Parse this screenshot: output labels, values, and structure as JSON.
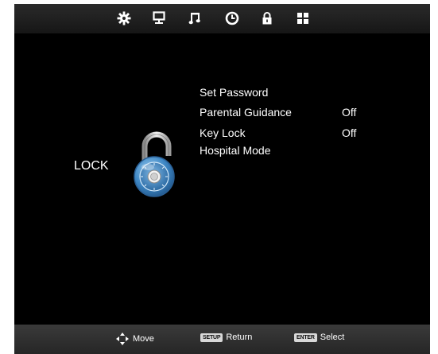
{
  "tabs": [
    {
      "icon": "gear-icon"
    },
    {
      "icon": "monitor-icon"
    },
    {
      "icon": "music-note-icon"
    },
    {
      "icon": "clock-icon"
    },
    {
      "icon": "padlock-icon",
      "selected": true
    },
    {
      "icon": "grid-icon"
    }
  ],
  "page": {
    "title": "LOCK",
    "graphic_icon": "combination-padlock-icon"
  },
  "menu": {
    "items": [
      {
        "label": "Set Password",
        "value": ""
      },
      {
        "label": "Parental Guidance",
        "value": "Off"
      },
      {
        "label": "Key Lock",
        "value": "Off"
      },
      {
        "label": "Hospital Mode",
        "value": ""
      }
    ]
  },
  "footer": {
    "move": {
      "icon": "dpad-arrows-icon",
      "label": "Move"
    },
    "return": {
      "key": "SETUP",
      "label": "Return"
    },
    "select": {
      "key": "ENTER",
      "label": "Select"
    }
  },
  "colors": {
    "background": "#000000",
    "text": "#ffffff",
    "bar": "#1f1f1f"
  }
}
